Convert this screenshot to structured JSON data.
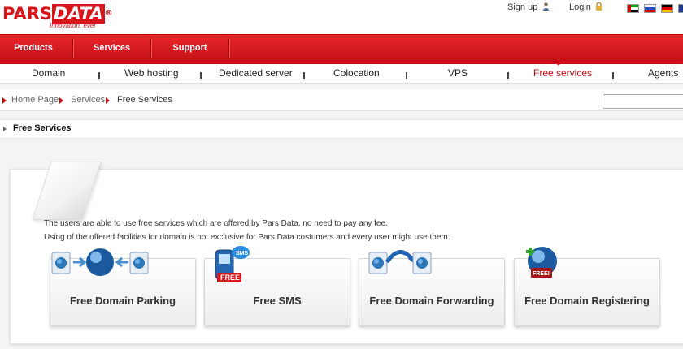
{
  "brand": {
    "name_a": "PARS",
    "name_b": "DATA",
    "reg": "®",
    "tagline": "Innovation, ever"
  },
  "util": {
    "signup": "Sign up",
    "login": "Login"
  },
  "main_nav": [
    "Products",
    "Services",
    "Support"
  ],
  "sub_nav": {
    "items": [
      "Domain",
      "Web hosting",
      "Dedicated server",
      "Colocation",
      "VPS",
      "Free services",
      "Agents"
    ],
    "active": "Free services"
  },
  "breadcrumb": [
    "Home Page",
    "Services",
    "Free Services"
  ],
  "search": {
    "placeholder": ""
  },
  "page_title": "Free Services",
  "intro": [
    "The users are able to use free services which are offered by Pars Data, no need to pay any fee.",
    "Using of the offered facilities for domain is not exclusive for Pars Data costumers and every user might use them."
  ],
  "cards": [
    "Free Domain Parking",
    "Free SMS",
    "Free Domain Forwarding",
    "Free Domain Registering"
  ],
  "icons": {
    "signup": "user-icon",
    "login": "lock-icon",
    "flags": [
      "uae-flag-icon",
      "russia-flag-icon",
      "germany-flag-icon",
      "uk-flag-icon"
    ]
  },
  "badges": {
    "free": "FREE",
    "free_bang": "FREE!",
    "sms": "SMS"
  },
  "colors": {
    "brand_red": "#d7141a",
    "nav_red": "#c40f14"
  }
}
